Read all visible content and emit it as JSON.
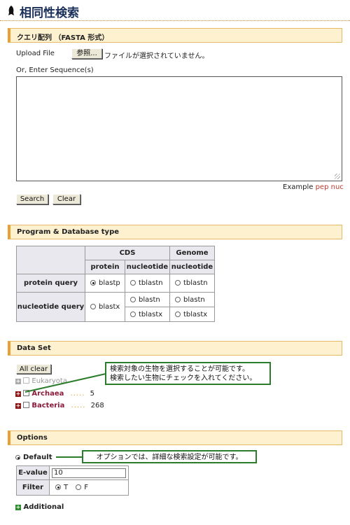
{
  "page": {
    "title": "相同性検索"
  },
  "query": {
    "section_title": "クエリ配列 （FASTA 形式）",
    "upload_label": "Upload File",
    "browse_button": "参照...",
    "no_file_text": "ファイルが選択されていません。",
    "enter_label": "Or, Enter Sequence(s)",
    "sequence_value": "",
    "example_label": "Example",
    "example_link_pep": "pep",
    "example_link_nuc": "nuc",
    "search_button": "Search",
    "clear_button": "Clear"
  },
  "program": {
    "section_title": "Program & Database type",
    "header_cds": "CDS",
    "header_genome": "Genome",
    "header_protein": "protein",
    "header_nucleotide": "nucleotide",
    "header_nucleotide_genome": "nucleotide",
    "row_protein": "protein query",
    "row_nucleotide": "nucleotide query",
    "opt_blastp": "blastp",
    "opt_tblastn_cds": "tblastn",
    "opt_tblastn_genome": "tblastn",
    "opt_blastx": "blastx",
    "opt_blastn_cds": "blastn",
    "opt_blastn_genome": "blastn",
    "opt_tblastx_cds": "tblastx",
    "opt_tblastx_genome": "tblastx",
    "selected": "blastp"
  },
  "dataset": {
    "section_title": "Data Set",
    "all_clear_button": "All clear",
    "callout_line1": "検索対象の生物を選択することが可能です。",
    "callout_line2": "検索したい生物にチェックを入れてください。",
    "items": [
      {
        "name": "Eukaryota",
        "count": ""
      },
      {
        "name": "Archaea",
        "count": "5"
      },
      {
        "name": "Bacteria",
        "count": "268"
      }
    ],
    "dots": "....."
  },
  "options": {
    "section_title": "Options",
    "default_label": "Default",
    "callout": "オプションでは、詳細な検索設定が可能です。",
    "evalue_label": "E-value",
    "evalue_value": "10",
    "filter_label": "Filter",
    "filter_t": "T",
    "filter_f": "F",
    "filter_selected": "T",
    "additional_label": "Additional"
  },
  "colors": {
    "accent": "#e8a032",
    "section_bg": "#fdf1cf",
    "callout_border": "#2b7c2b",
    "taxon": "#8b1b3a"
  }
}
